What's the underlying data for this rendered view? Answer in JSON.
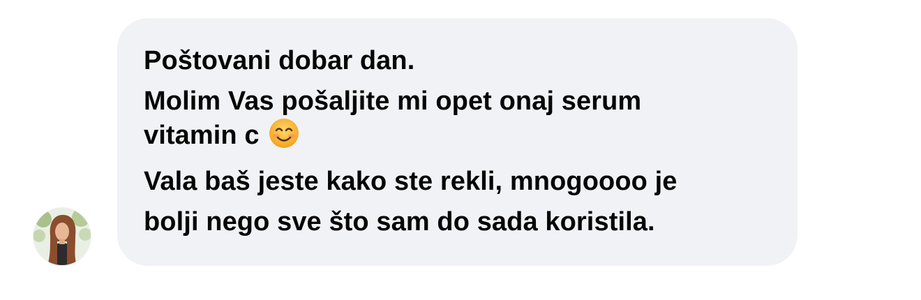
{
  "message": {
    "lines": [
      "Poštovani dobar dan.",
      "Molim Vas pošaljite mi opet onaj serum",
      "vitamin c",
      "Vala baš jeste kako ste rekli, mnogoooo je",
      "bolji nego sve što sam do sada koristila."
    ],
    "emoji": "smiling-face-with-smiling-eyes"
  },
  "colors": {
    "bubble": "#f1f2f6",
    "text": "#050505",
    "background": "#ffffff"
  }
}
